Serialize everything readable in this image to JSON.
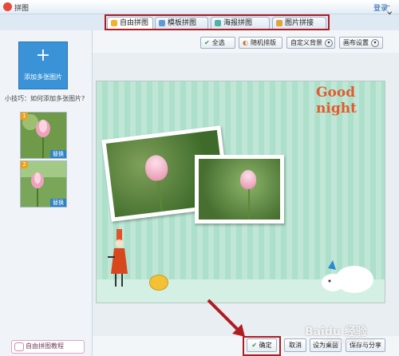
{
  "window": {
    "title": "拼图",
    "login_label": "登录",
    "controls": "– ✕"
  },
  "tabs": [
    {
      "label": "自由拼图",
      "icon": "free-puzzle-icon",
      "active": true,
      "color": "#f2b230"
    },
    {
      "label": "模板拼图",
      "icon": "template-puzzle-icon",
      "active": false,
      "color": "#5f9bd3"
    },
    {
      "label": "海报拼图",
      "icon": "poster-puzzle-icon",
      "active": false,
      "color": "#4db3a3"
    },
    {
      "label": "图片拼接",
      "icon": "image-join-icon",
      "active": false,
      "color": "#e0a43a"
    }
  ],
  "sidebar": {
    "add_button_label": "添加多张图片",
    "add_button_plus": "+",
    "tip": "小技巧：如何添加多张图片?",
    "thumbnails": [
      {
        "number": "1",
        "replace_label": "替换"
      },
      {
        "number": "2",
        "replace_label": "替换"
      }
    ],
    "tutorial_label": "自由拼图教程"
  },
  "toolbar": {
    "select_all": "全选",
    "random_layout": "随机排版",
    "custom_background": "自定义背景",
    "canvas_settings": "画布设置"
  },
  "canvas": {
    "title_text": "Good night"
  },
  "bottom": {
    "confirm": "确定",
    "cancel": "取消",
    "set_desktop": "设为桌面",
    "save_share": "保存与分享"
  },
  "watermark": {
    "text": "Baidu 经验",
    "url": "jingyan.baidu.com"
  },
  "colors": {
    "accent_blue": "#3a93d6",
    "highlight_red": "#b01c20",
    "canvas_green": "#bfe6d6",
    "title_orange": "#e55a2b"
  }
}
